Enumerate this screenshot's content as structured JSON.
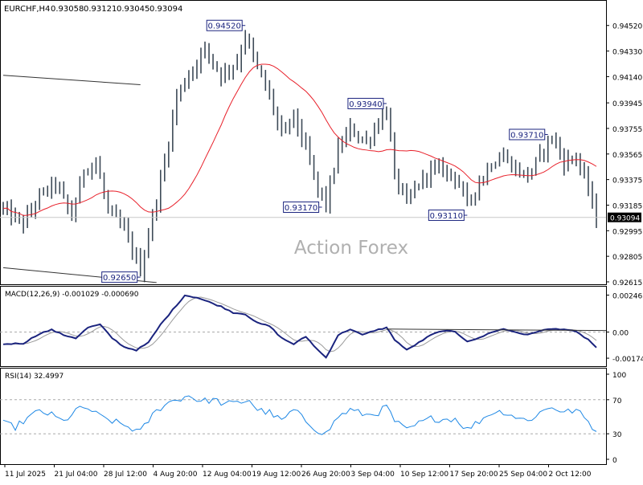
{
  "header": {
    "symbol": "EURCHF,H4",
    "open": "0.93058",
    "high": "0.93121",
    "low": "0.93045",
    "close": "0.93094"
  },
  "watermark": "Action Forex",
  "chart_data": [
    {
      "type": "candlestick",
      "name": "price",
      "ylim": [
        0.92615,
        0.9459
      ],
      "y_ticks": [
        "0.94520",
        "0.94330",
        "0.94140",
        "0.93945",
        "0.93755",
        "0.93565",
        "0.93375",
        "0.93185",
        "0.92995",
        "0.92805",
        "0.92615"
      ],
      "current_price": "0.93094",
      "x_labels": [
        "11 Jul 2025",
        "21 Jul 04:00",
        "28 Jul 12:00",
        "4 Aug 20:00",
        "12 Aug 04:00",
        "19 Aug 12:00",
        "26 Aug 20:00",
        "3 Sep 04:00",
        "10 Sep 12:00",
        "17 Sep 20:00",
        "25 Sep 04:00",
        "2 Oct 12:00"
      ],
      "annotations": [
        {
          "text": "0.94520",
          "bar": 60,
          "price": 0.9452
        },
        {
          "text": "0.93940",
          "bar": 95,
          "price": 0.9394
        },
        {
          "text": "0.93170",
          "bar": 79,
          "price": 0.9317
        },
        {
          "text": "0.93110",
          "bar": 115,
          "price": 0.9311
        },
        {
          "text": "0.93710",
          "bar": 135,
          "price": 0.9371
        },
        {
          "text": "0.92650",
          "bar": 34,
          "price": 0.9265
        }
      ],
      "trendlines": [
        {
          "from": [
            0,
            0.9415
          ],
          "to": [
            34,
            0.9408
          ]
        },
        {
          "from": [
            0,
            0.9272
          ],
          "to": [
            38,
            0.9261
          ]
        }
      ],
      "ma_color": "#e8202a",
      "candle_color": "#3d4a57",
      "key_points": [
        [
          0,
          0.9315
        ],
        [
          5,
          0.9305
        ],
        [
          9,
          0.9325
        ],
        [
          13,
          0.9335
        ],
        [
          17,
          0.931
        ],
        [
          20,
          0.9345
        ],
        [
          23,
          0.935
        ],
        [
          26,
          0.9315
        ],
        [
          30,
          0.93
        ],
        [
          34,
          0.927
        ],
        [
          37,
          0.931
        ],
        [
          40,
          0.935
        ],
        [
          43,
          0.94
        ],
        [
          47,
          0.942
        ],
        [
          50,
          0.9435
        ],
        [
          54,
          0.9415
        ],
        [
          58,
          0.9425
        ],
        [
          60,
          0.9445
        ],
        [
          63,
          0.942
        ],
        [
          66,
          0.94
        ],
        [
          69,
          0.937
        ],
        [
          72,
          0.9385
        ],
        [
          75,
          0.936
        ],
        [
          78,
          0.933
        ],
        [
          80,
          0.932
        ],
        [
          83,
          0.936
        ],
        [
          86,
          0.9375
        ],
        [
          90,
          0.9365
        ],
        [
          93,
          0.938
        ],
        [
          95,
          0.939
        ],
        [
          97,
          0.934
        ],
        [
          100,
          0.932
        ],
        [
          103,
          0.9335
        ],
        [
          106,
          0.9345
        ],
        [
          109,
          0.9345
        ],
        [
          112,
          0.934
        ],
        [
          115,
          0.932
        ],
        [
          118,
          0.9335
        ],
        [
          121,
          0.935
        ],
        [
          124,
          0.9355
        ],
        [
          127,
          0.9345
        ],
        [
          130,
          0.934
        ],
        [
          133,
          0.9355
        ],
        [
          136,
          0.937
        ],
        [
          139,
          0.935
        ],
        [
          142,
          0.9355
        ],
        [
          145,
          0.933
        ],
        [
          147,
          0.93094
        ]
      ]
    },
    {
      "type": "line",
      "name": "MACD",
      "label": "MACD(12,26,9) -0.001029 -0.000690",
      "ylim": [
        -0.00195,
        0.00265
      ],
      "y_ticks": [
        "0.002463",
        "0.00",
        "-0.00174"
      ],
      "series_color": "#1a237e",
      "signal_color": "#9a9a9a",
      "trendline": {
        "from": [
          95,
          0.0002
        ],
        "to": [
          147,
          0.0001
        ]
      },
      "key_points": [
        [
          0,
          -0.0008
        ],
        [
          5,
          -0.00075
        ],
        [
          9,
          -0.0001
        ],
        [
          12,
          0.00015
        ],
        [
          15,
          -0.0002
        ],
        [
          18,
          -0.0004
        ],
        [
          21,
          0.0003
        ],
        [
          24,
          0.0005
        ],
        [
          27,
          -0.0004
        ],
        [
          30,
          -0.001
        ],
        [
          33,
          -0.0012
        ],
        [
          36,
          -0.0007
        ],
        [
          39,
          0.0005
        ],
        [
          43,
          0.0018
        ],
        [
          45,
          0.00245
        ],
        [
          48,
          0.0023
        ],
        [
          51,
          0.002
        ],
        [
          54,
          0.0017
        ],
        [
          57,
          0.0013
        ],
        [
          60,
          0.0012
        ],
        [
          63,
          0.0006
        ],
        [
          66,
          0.0004
        ],
        [
          69,
          -0.0004
        ],
        [
          72,
          -0.0008
        ],
        [
          75,
          -0.0003
        ],
        [
          78,
          -0.0012
        ],
        [
          80,
          -0.0017
        ],
        [
          83,
          -0.0002
        ],
        [
          86,
          0.0002
        ],
        [
          89,
          -0.0002
        ],
        [
          92,
          0.0001
        ],
        [
          95,
          0.0003
        ],
        [
          97,
          -0.0005
        ],
        [
          100,
          -0.0012
        ],
        [
          103,
          -0.0007
        ],
        [
          106,
          -0.0002
        ],
        [
          109,
          0.0001
        ],
        [
          112,
          0.0
        ],
        [
          115,
          -0.0006
        ],
        [
          118,
          -0.0004
        ],
        [
          121,
          0.0
        ],
        [
          124,
          0.0002
        ],
        [
          127,
          0.0
        ],
        [
          130,
          -0.0002
        ],
        [
          133,
          0.0001
        ],
        [
          136,
          0.0002
        ],
        [
          139,
          0.0002
        ],
        [
          142,
          0.0
        ],
        [
          145,
          -0.0005
        ],
        [
          147,
          -0.00103
        ]
      ]
    },
    {
      "type": "line",
      "name": "RSI",
      "label": "RSI(14) 32.4997",
      "ylim": [
        0,
        100
      ],
      "y_ticks": [
        "100",
        "70",
        "30",
        "0"
      ],
      "levels": [
        70,
        30
      ],
      "series_color": "#1e88e5",
      "key_points": [
        [
          0,
          42
        ],
        [
          3,
          38
        ],
        [
          6,
          48
        ],
        [
          9,
          57
        ],
        [
          12,
          52
        ],
        [
          15,
          44
        ],
        [
          18,
          58
        ],
        [
          21,
          60
        ],
        [
          24,
          50
        ],
        [
          27,
          45
        ],
        [
          30,
          40
        ],
        [
          34,
          32
        ],
        [
          37,
          52
        ],
        [
          40,
          65
        ],
        [
          43,
          70
        ],
        [
          46,
          75
        ],
        [
          49,
          68
        ],
        [
          52,
          70
        ],
        [
          55,
          65
        ],
        [
          58,
          66
        ],
        [
          61,
          70
        ],
        [
          63,
          58
        ],
        [
          66,
          55
        ],
        [
          69,
          45
        ],
        [
          72,
          58
        ],
        [
          75,
          45
        ],
        [
          78,
          34
        ],
        [
          80,
          30
        ],
        [
          83,
          50
        ],
        [
          86,
          58
        ],
        [
          90,
          52
        ],
        [
          93,
          55
        ],
        [
          95,
          62
        ],
        [
          97,
          45
        ],
        [
          100,
          34
        ],
        [
          103,
          42
        ],
        [
          106,
          48
        ],
        [
          109,
          47
        ],
        [
          112,
          48
        ],
        [
          115,
          35
        ],
        [
          118,
          45
        ],
        [
          121,
          55
        ],
        [
          124,
          56
        ],
        [
          127,
          50
        ],
        [
          130,
          45
        ],
        [
          133,
          55
        ],
        [
          136,
          62
        ],
        [
          139,
          55
        ],
        [
          142,
          58
        ],
        [
          145,
          44
        ],
        [
          147,
          32.5
        ]
      ]
    }
  ]
}
